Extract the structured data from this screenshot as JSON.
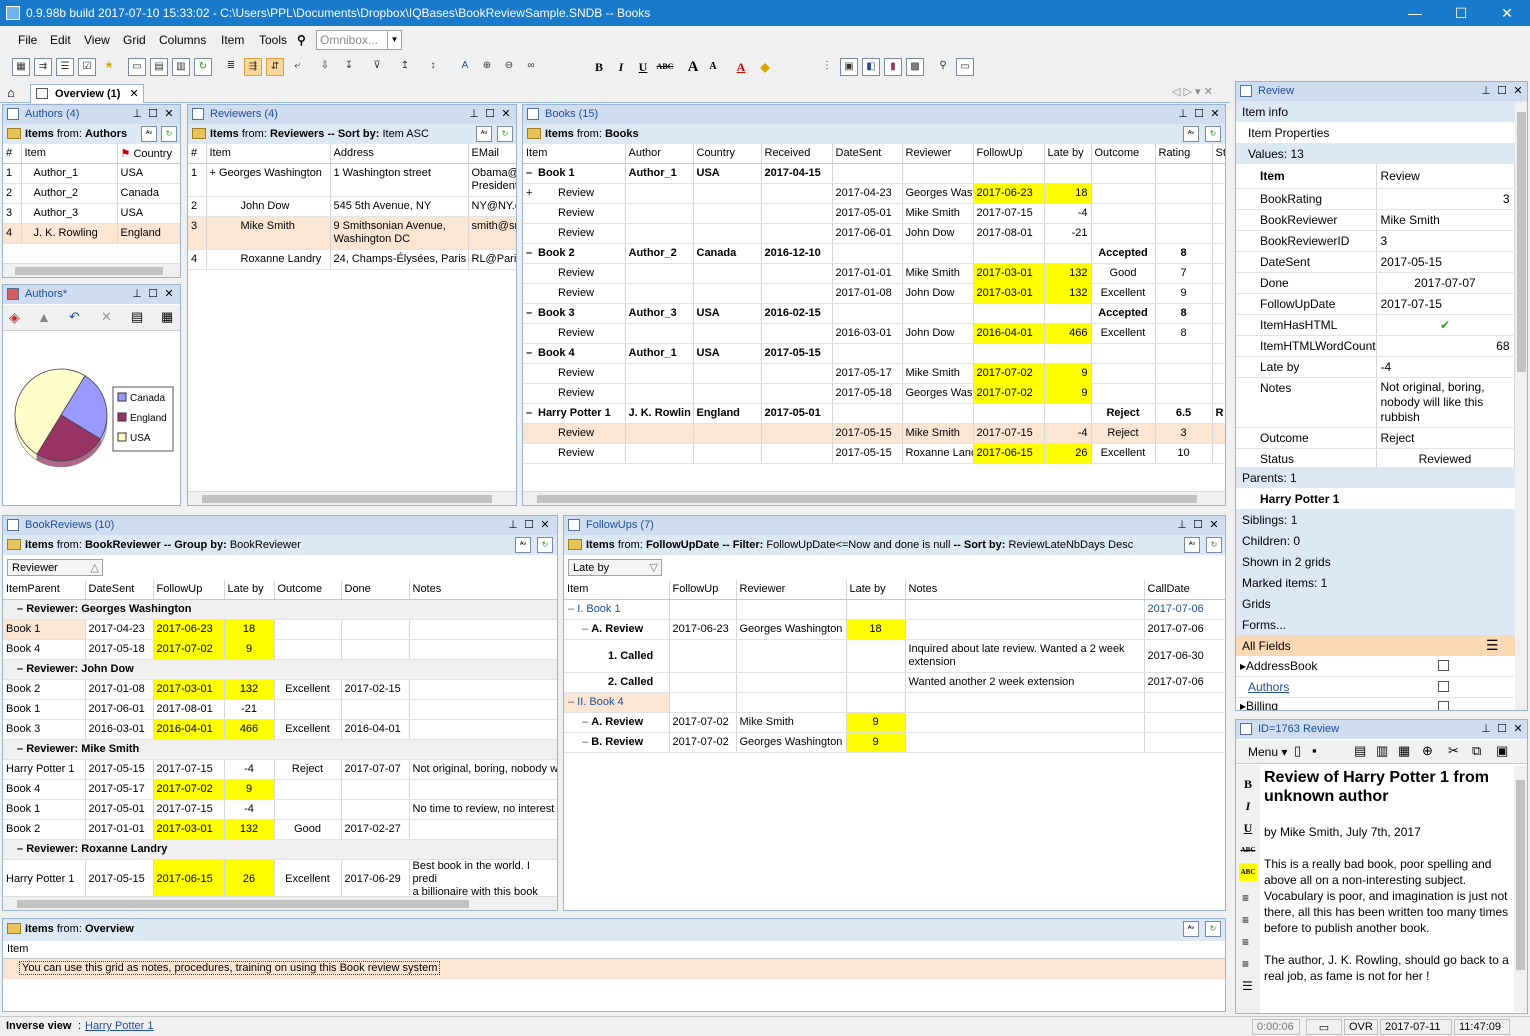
{
  "window": {
    "title": "0.9.98b  build 2017-07-10 15:33:02 - C:\\Users\\PPL\\Documents\\Dropbox\\IQBases\\BookReviewSample.SNDB -- Books",
    "minimize": "—",
    "maximize": "☐",
    "close": "✕"
  },
  "menu": [
    "File",
    "Edit",
    "View",
    "Grid",
    "Columns",
    "Item",
    "Tools"
  ],
  "omnibox": {
    "placeholder": "Omnibox..."
  },
  "tabs": {
    "overview": "Overview (1)"
  },
  "authors": {
    "title": "Authors (4)",
    "items_prefix": "Items",
    "items_from": "from:",
    "items_source": "Authors",
    "columns": [
      "#",
      "Item",
      "Country"
    ],
    "rows": [
      [
        "1",
        "Author_1",
        "USA"
      ],
      [
        "2",
        "Author_2",
        "Canada"
      ],
      [
        "3",
        "Author_3",
        "USA"
      ],
      [
        "4",
        "J. K. Rowling",
        "England"
      ]
    ]
  },
  "chart_panel": {
    "title": "Authors*"
  },
  "chart_data": {
    "type": "pie",
    "title": "",
    "categories": [
      "Canada",
      "England",
      "USA"
    ],
    "values": [
      1,
      1,
      2
    ],
    "colors": [
      "#9999ff",
      "#993366",
      "#ffffcc"
    ],
    "legend": "right"
  },
  "reviewers": {
    "title": "Reviewers (4)",
    "items_prefix": "Items",
    "items_from": "from:",
    "items_source": "Reviewers",
    "sort_label": "-- Sort by:",
    "sort_value": "Item ASC",
    "columns": [
      "#",
      "Item",
      "Address",
      "EMail"
    ],
    "rows": [
      [
        "1",
        "Georges Washington",
        "1 Washington street",
        "Obama@\nPresident"
      ],
      [
        "2",
        "John Dow",
        "545 5th Avenue, NY",
        "NY@NY.c"
      ],
      [
        "3",
        "Mike Smith",
        "9 Smithsonian Avenue,\nWashington DC",
        "smith@sn"
      ],
      [
        "4",
        "Roxanne Landry",
        "24, Champs-Élysées, Paris",
        "RL@Paris"
      ]
    ]
  },
  "books": {
    "title": "Books (15)",
    "items_prefix": "Items",
    "items_from": "from:",
    "items_source": "Books",
    "columns": [
      "Item",
      "Author",
      "Country",
      "Received",
      "DateSent",
      "Reviewer",
      "FollowUp",
      "Late by",
      "Outcome",
      "Rating",
      "St"
    ],
    "rows": [
      [
        "–",
        "Book 1",
        "Author_1",
        "USA",
        "2017-04-15",
        "",
        "",
        "",
        "",
        "",
        "",
        ""
      ],
      [
        "+",
        "Review",
        "",
        "",
        "",
        "2017-04-23",
        "Georges Was",
        "2017-06-23",
        "18",
        "",
        "",
        ""
      ],
      [
        "",
        "Review",
        "",
        "",
        "",
        "2017-05-01",
        "Mike Smith",
        "2017-07-15",
        "-4",
        "",
        "",
        ""
      ],
      [
        "",
        "Review",
        "",
        "",
        "",
        "2017-06-01",
        "John Dow",
        "2017-08-01",
        "-21",
        "",
        "",
        ""
      ],
      [
        "–",
        "Book 2",
        "Author_2",
        "Canada",
        "2016-12-10",
        "",
        "",
        "",
        "",
        "Accepted",
        "8",
        ""
      ],
      [
        "",
        "Review",
        "",
        "",
        "",
        "2017-01-01",
        "Mike Smith",
        "2017-03-01",
        "132",
        "Good",
        "7",
        ""
      ],
      [
        "",
        "Review",
        "",
        "",
        "",
        "2017-01-08",
        "John Dow",
        "2017-03-01",
        "132",
        "Excellent",
        "9",
        ""
      ],
      [
        "–",
        "Book 3",
        "Author_3",
        "USA",
        "2016-02-15",
        "",
        "",
        "",
        "",
        "Accepted",
        "8",
        ""
      ],
      [
        "",
        "Review",
        "",
        "",
        "",
        "2016-03-01",
        "John Dow",
        "2016-04-01",
        "466",
        "Excellent",
        "8",
        ""
      ],
      [
        "–",
        "Book 4",
        "Author_1",
        "USA",
        "2017-05-15",
        "",
        "",
        "",
        "",
        "",
        "",
        ""
      ],
      [
        "",
        "Review",
        "",
        "",
        "",
        "2017-05-17",
        "Mike Smith",
        "2017-07-02",
        "9",
        "",
        "",
        ""
      ],
      [
        "",
        "Review",
        "",
        "",
        "",
        "2017-05-18",
        "Georges Was",
        "2017-07-02",
        "9",
        "",
        "",
        ""
      ],
      [
        "–",
        "Harry Potter 1",
        "J. K. Rowlin",
        "England",
        "2017-05-01",
        "",
        "",
        "",
        "",
        "Reject",
        "6.5",
        "R"
      ],
      [
        "",
        "Review",
        "",
        "",
        "",
        "2017-05-15",
        "Mike Smith",
        "2017-07-15",
        "-4",
        "Reject",
        "3",
        ""
      ],
      [
        "",
        "Review",
        "",
        "",
        "",
        "2017-05-15",
        "Roxanne Land",
        "2017-06-15",
        "26",
        "Excellent",
        "10",
        ""
      ]
    ]
  },
  "bookreviews": {
    "title": "BookReviews (10)",
    "items_prefix": "Items",
    "items_from": "from:",
    "items_source": "BookReviewer",
    "group_label": "-- Group by:",
    "group_value": "BookReviewer",
    "group_field": "Reviewer",
    "columns": [
      "ItemParent",
      "DateSent",
      "FollowUp",
      "Late by",
      "Outcome",
      "Done",
      "Notes"
    ],
    "rows": [
      [
        "g",
        "Reviewer: Georges Washington"
      ],
      [
        "r",
        "Book 1",
        "2017-04-23",
        "2017-06-23",
        "18",
        "",
        "",
        ""
      ],
      [
        "r",
        "Book 4",
        "2017-05-18",
        "2017-07-02",
        "9",
        "",
        "",
        ""
      ],
      [
        "g",
        "Reviewer: John Dow"
      ],
      [
        "r",
        "Book 2",
        "2017-01-08",
        "2017-03-01",
        "132",
        "Excellent",
        "2017-02-15",
        ""
      ],
      [
        "r",
        "Book 1",
        "2017-06-01",
        "2017-08-01",
        "-21",
        "",
        "",
        ""
      ],
      [
        "r",
        "Book 3",
        "2016-03-01",
        "2016-04-01",
        "466",
        "Excellent",
        "2016-04-01",
        ""
      ],
      [
        "g",
        "Reviewer: Mike Smith"
      ],
      [
        "r",
        "Harry Potter 1",
        "2017-05-15",
        "2017-07-15",
        "-4",
        "Reject",
        "2017-07-07",
        "Not original, boring, nobody w"
      ],
      [
        "r",
        "Book 4",
        "2017-05-17",
        "2017-07-02",
        "9",
        "",
        "",
        ""
      ],
      [
        "r",
        "Book 1",
        "2017-05-01",
        "2017-07-15",
        "-4",
        "",
        "",
        "No time to review, no interest"
      ],
      [
        "r",
        "Book 2",
        "2017-01-01",
        "2017-03-01",
        "132",
        "Good",
        "2017-02-27",
        ""
      ],
      [
        "g",
        "Reviewer: Roxanne Landry"
      ],
      [
        "r",
        "Harry Potter 1",
        "2017-05-15",
        "2017-06-15",
        "26",
        "Excellent",
        "2017-06-29",
        "Best book in the world. I predi\na billionaire with this book"
      ]
    ]
  },
  "followups": {
    "title": "FollowUps (7)",
    "items_prefix": "Items",
    "items_from": "from:",
    "items_source": "FollowUpDate",
    "filter_label": "-- Filter:",
    "filter_value": "FollowUpDate<=Now and done is null",
    "sort_label": "-- Sort by:",
    "sort_value": "ReviewLateNbDays Desc",
    "group_field": "Late by",
    "columns": [
      "Item",
      "FollowUp",
      "Reviewer",
      "Late by",
      "Notes",
      "CallDate"
    ],
    "rows": [
      [
        "0",
        "I. Book 1",
        "",
        "",
        "",
        "",
        "2017-07-06"
      ],
      [
        "1",
        "A. Review",
        "2017-06-23",
        "Georges Washington",
        "18",
        "",
        "2017-07-06"
      ],
      [
        "2",
        "1. Called",
        "",
        "",
        "",
        "Inquired about late review. Wanted a 2 week\nextension",
        "2017-06-30"
      ],
      [
        "2",
        "2. Called",
        "",
        "",
        "",
        "Wanted another 2 week extension",
        "2017-07-06"
      ],
      [
        "0",
        "II. Book 4",
        "",
        "",
        "",
        "",
        ""
      ],
      [
        "1",
        "A. Review",
        "2017-07-02",
        "Mike Smith",
        "9",
        "",
        ""
      ],
      [
        "1",
        "B. Review",
        "2017-07-02",
        "Georges Washington",
        "9",
        "",
        ""
      ]
    ]
  },
  "overview": {
    "items_prefix": "Items",
    "items_from": "from:",
    "items_source": "Overview",
    "column": "Item",
    "note": "You can use this grid as notes, procedures, training on using this Book review system"
  },
  "review_panel": {
    "title": "Review",
    "item_info": "Item info",
    "item_properties": "Item Properties",
    "values": "Values: 13",
    "props": [
      [
        "Item",
        "Review"
      ],
      [
        "BookRating",
        "3"
      ],
      [
        "BookReviewer",
        "Mike Smith"
      ],
      [
        "BookReviewerID",
        "3"
      ],
      [
        "DateSent",
        "2017-05-15"
      ],
      [
        "Done",
        "2017-07-07"
      ],
      [
        "FollowUpDate",
        "2017-07-15"
      ],
      [
        "ItemHasHTML",
        "✔"
      ],
      [
        "ItemHTMLWordCount",
        "68"
      ],
      [
        "Late by",
        "-4"
      ],
      [
        "Notes",
        "Not original, boring,\nnobody will like this\nrubbish"
      ],
      [
        "Outcome",
        "Reject"
      ],
      [
        "Status",
        "Reviewed"
      ]
    ],
    "parents": "Parents: 1",
    "parent_item": "Harry Potter 1",
    "siblings": "Siblings: 1",
    "children": "Children: 0",
    "shown_in": "Shown in 2 grids",
    "marked": "Marked items: 1",
    "grids": "Grids",
    "forms": "Forms...",
    "all_fields": "All Fields",
    "fields": [
      "AddressBook",
      "Authors",
      "Billing"
    ]
  },
  "html_panel": {
    "title": "ID=1763 Review",
    "menu": "Menu",
    "heading": "Review of Harry Potter 1 from unknown author",
    "byline": "by Mike Smith, July 7th, 2017",
    "para1": "This is a really bad book, poor spelling and above all on a non-interesting subject. Vocabulary is poor, and imagination is just not there, all this has been written too many times before to publish another book.",
    "para2": "The author, J. K. Rowling, should go back to a real job, as fame is not for her !"
  },
  "status": {
    "label": "Inverse view",
    "sep": ":",
    "link": "Harry Potter 1",
    "timer": "0:00:06",
    "mode": "OVR",
    "date": "2017-07-11",
    "time": "11:47:09"
  }
}
